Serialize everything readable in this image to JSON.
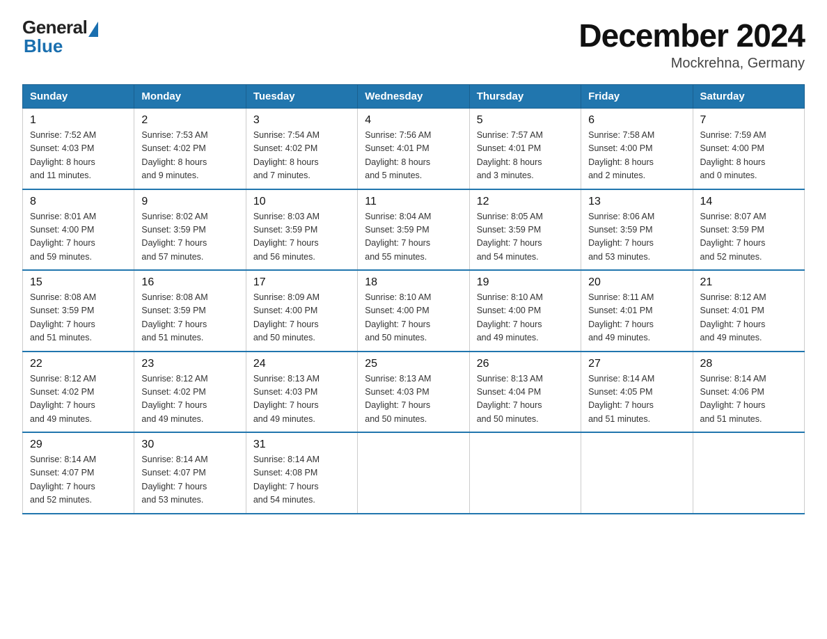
{
  "header": {
    "logo_general": "General",
    "logo_blue": "Blue",
    "month_year": "December 2024",
    "location": "Mockrehna, Germany"
  },
  "days_of_week": [
    "Sunday",
    "Monday",
    "Tuesday",
    "Wednesday",
    "Thursday",
    "Friday",
    "Saturday"
  ],
  "weeks": [
    [
      {
        "day": "1",
        "info": "Sunrise: 7:52 AM\nSunset: 4:03 PM\nDaylight: 8 hours\nand 11 minutes."
      },
      {
        "day": "2",
        "info": "Sunrise: 7:53 AM\nSunset: 4:02 PM\nDaylight: 8 hours\nand 9 minutes."
      },
      {
        "day": "3",
        "info": "Sunrise: 7:54 AM\nSunset: 4:02 PM\nDaylight: 8 hours\nand 7 minutes."
      },
      {
        "day": "4",
        "info": "Sunrise: 7:56 AM\nSunset: 4:01 PM\nDaylight: 8 hours\nand 5 minutes."
      },
      {
        "day": "5",
        "info": "Sunrise: 7:57 AM\nSunset: 4:01 PM\nDaylight: 8 hours\nand 3 minutes."
      },
      {
        "day": "6",
        "info": "Sunrise: 7:58 AM\nSunset: 4:00 PM\nDaylight: 8 hours\nand 2 minutes."
      },
      {
        "day": "7",
        "info": "Sunrise: 7:59 AM\nSunset: 4:00 PM\nDaylight: 8 hours\nand 0 minutes."
      }
    ],
    [
      {
        "day": "8",
        "info": "Sunrise: 8:01 AM\nSunset: 4:00 PM\nDaylight: 7 hours\nand 59 minutes."
      },
      {
        "day": "9",
        "info": "Sunrise: 8:02 AM\nSunset: 3:59 PM\nDaylight: 7 hours\nand 57 minutes."
      },
      {
        "day": "10",
        "info": "Sunrise: 8:03 AM\nSunset: 3:59 PM\nDaylight: 7 hours\nand 56 minutes."
      },
      {
        "day": "11",
        "info": "Sunrise: 8:04 AM\nSunset: 3:59 PM\nDaylight: 7 hours\nand 55 minutes."
      },
      {
        "day": "12",
        "info": "Sunrise: 8:05 AM\nSunset: 3:59 PM\nDaylight: 7 hours\nand 54 minutes."
      },
      {
        "day": "13",
        "info": "Sunrise: 8:06 AM\nSunset: 3:59 PM\nDaylight: 7 hours\nand 53 minutes."
      },
      {
        "day": "14",
        "info": "Sunrise: 8:07 AM\nSunset: 3:59 PM\nDaylight: 7 hours\nand 52 minutes."
      }
    ],
    [
      {
        "day": "15",
        "info": "Sunrise: 8:08 AM\nSunset: 3:59 PM\nDaylight: 7 hours\nand 51 minutes."
      },
      {
        "day": "16",
        "info": "Sunrise: 8:08 AM\nSunset: 3:59 PM\nDaylight: 7 hours\nand 51 minutes."
      },
      {
        "day": "17",
        "info": "Sunrise: 8:09 AM\nSunset: 4:00 PM\nDaylight: 7 hours\nand 50 minutes."
      },
      {
        "day": "18",
        "info": "Sunrise: 8:10 AM\nSunset: 4:00 PM\nDaylight: 7 hours\nand 50 minutes."
      },
      {
        "day": "19",
        "info": "Sunrise: 8:10 AM\nSunset: 4:00 PM\nDaylight: 7 hours\nand 49 minutes."
      },
      {
        "day": "20",
        "info": "Sunrise: 8:11 AM\nSunset: 4:01 PM\nDaylight: 7 hours\nand 49 minutes."
      },
      {
        "day": "21",
        "info": "Sunrise: 8:12 AM\nSunset: 4:01 PM\nDaylight: 7 hours\nand 49 minutes."
      }
    ],
    [
      {
        "day": "22",
        "info": "Sunrise: 8:12 AM\nSunset: 4:02 PM\nDaylight: 7 hours\nand 49 minutes."
      },
      {
        "day": "23",
        "info": "Sunrise: 8:12 AM\nSunset: 4:02 PM\nDaylight: 7 hours\nand 49 minutes."
      },
      {
        "day": "24",
        "info": "Sunrise: 8:13 AM\nSunset: 4:03 PM\nDaylight: 7 hours\nand 49 minutes."
      },
      {
        "day": "25",
        "info": "Sunrise: 8:13 AM\nSunset: 4:03 PM\nDaylight: 7 hours\nand 50 minutes."
      },
      {
        "day": "26",
        "info": "Sunrise: 8:13 AM\nSunset: 4:04 PM\nDaylight: 7 hours\nand 50 minutes."
      },
      {
        "day": "27",
        "info": "Sunrise: 8:14 AM\nSunset: 4:05 PM\nDaylight: 7 hours\nand 51 minutes."
      },
      {
        "day": "28",
        "info": "Sunrise: 8:14 AM\nSunset: 4:06 PM\nDaylight: 7 hours\nand 51 minutes."
      }
    ],
    [
      {
        "day": "29",
        "info": "Sunrise: 8:14 AM\nSunset: 4:07 PM\nDaylight: 7 hours\nand 52 minutes."
      },
      {
        "day": "30",
        "info": "Sunrise: 8:14 AM\nSunset: 4:07 PM\nDaylight: 7 hours\nand 53 minutes."
      },
      {
        "day": "31",
        "info": "Sunrise: 8:14 AM\nSunset: 4:08 PM\nDaylight: 7 hours\nand 54 minutes."
      },
      {
        "day": "",
        "info": ""
      },
      {
        "day": "",
        "info": ""
      },
      {
        "day": "",
        "info": ""
      },
      {
        "day": "",
        "info": ""
      }
    ]
  ]
}
